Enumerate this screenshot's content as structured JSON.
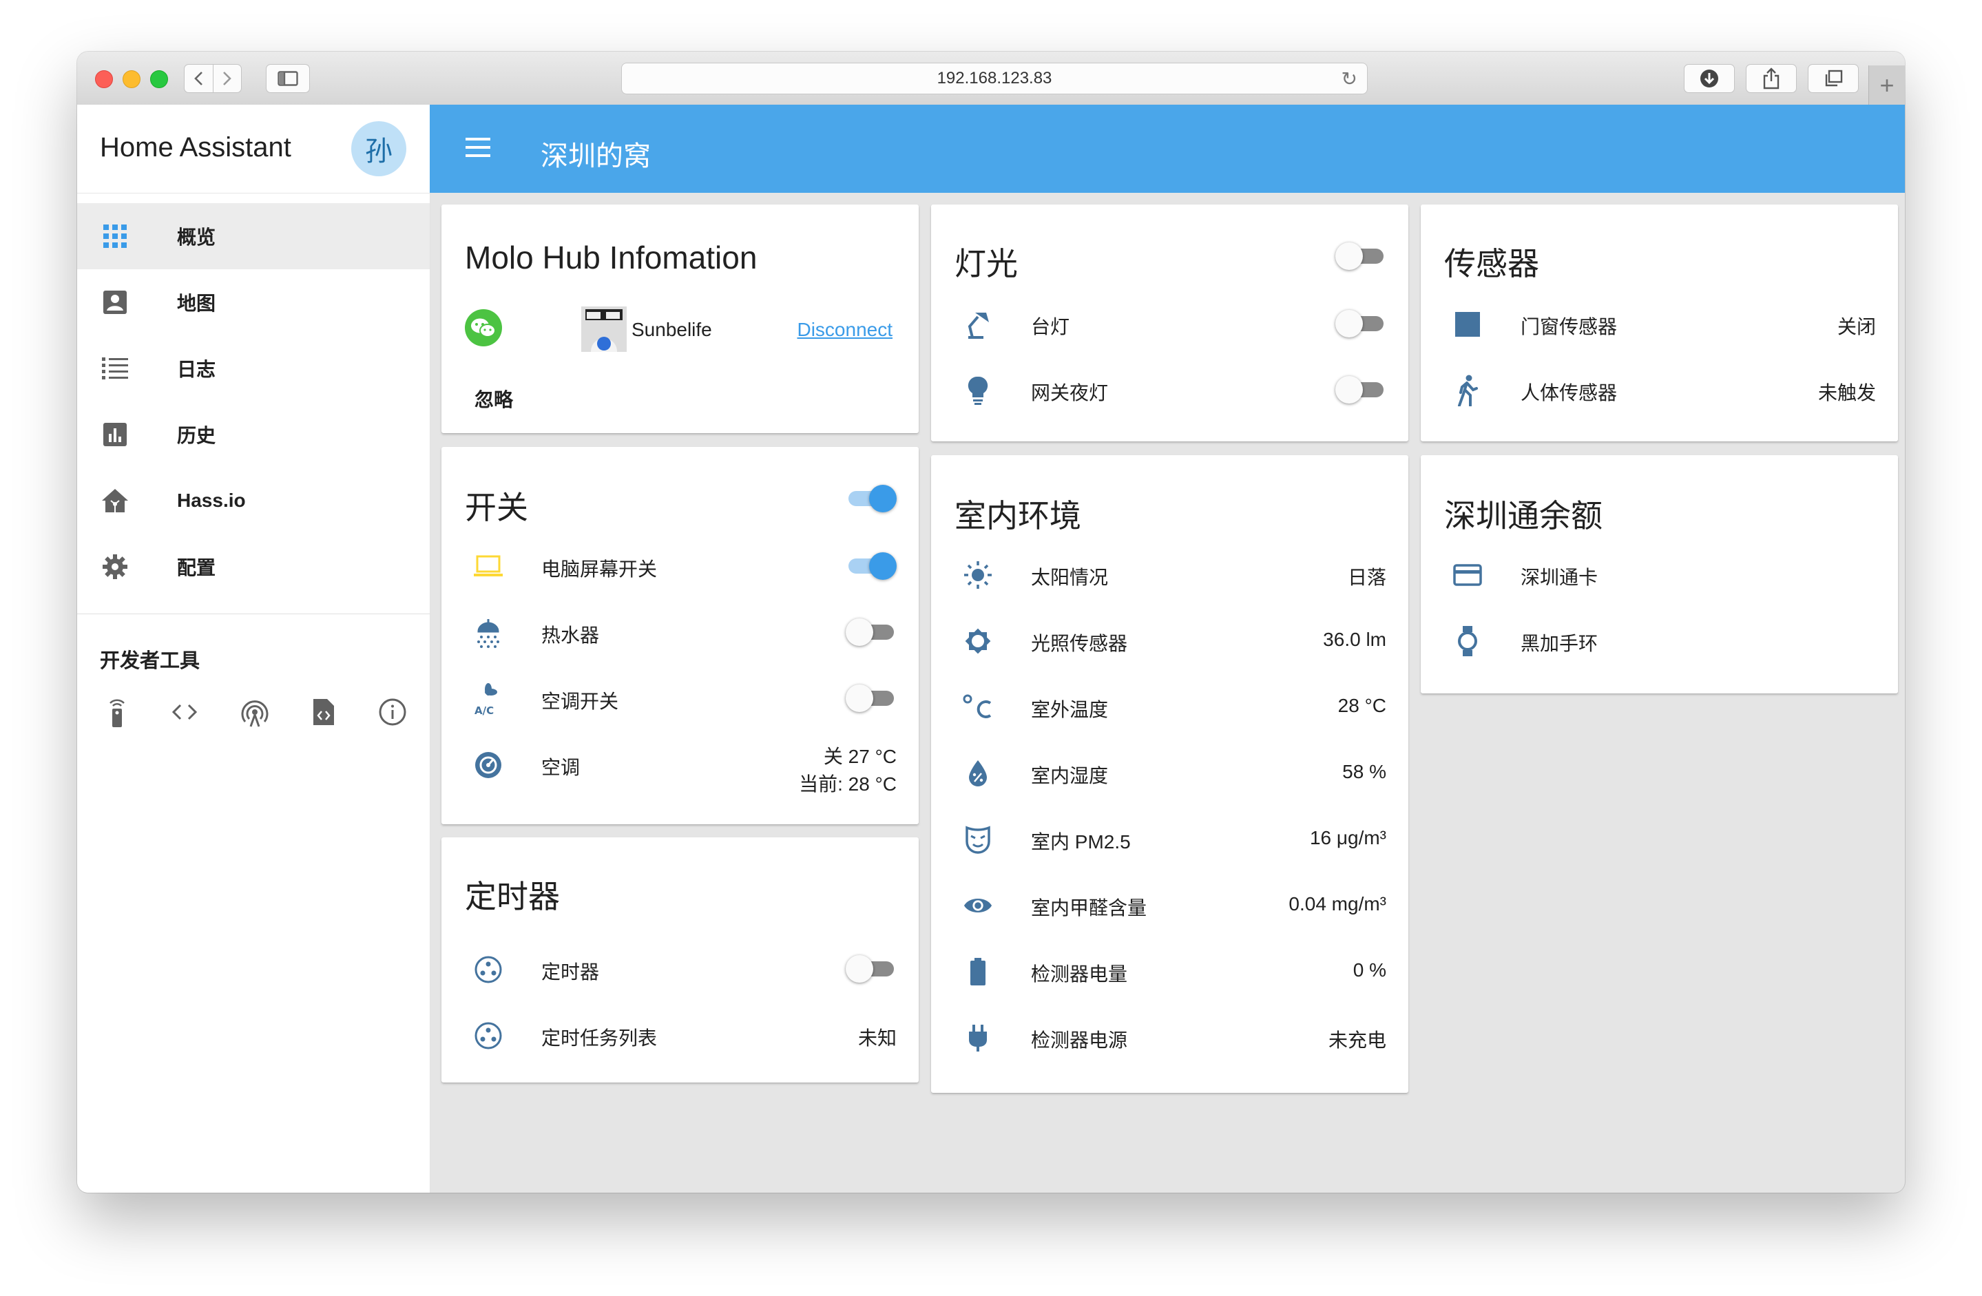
{
  "browser": {
    "url": "192.168.123.83"
  },
  "sidebar": {
    "title": "Home Assistant",
    "avatar_letter": "孙",
    "items": [
      {
        "label": "概览",
        "icon": "view-grid-icon",
        "active": true
      },
      {
        "label": "地图",
        "icon": "account-box-icon"
      },
      {
        "label": "日志",
        "icon": "format-list-icon"
      },
      {
        "label": "历史",
        "icon": "chart-box-icon"
      },
      {
        "label": "Hass.io",
        "icon": "home-assistant-icon"
      },
      {
        "label": "配置",
        "icon": "gear-icon"
      }
    ],
    "dev_tools_title": "开发者工具",
    "dev_tools": [
      "remote-icon",
      "code-brackets-icon",
      "antenna-icon",
      "file-code-icon",
      "info-icon"
    ]
  },
  "header": {
    "title": "深圳的窝"
  },
  "cards": {
    "molo": {
      "title": "Molo Hub Infomation",
      "user": "Sunbelife",
      "disconnect": "Disconnect",
      "ignore": "忽略"
    },
    "switches": {
      "title": "开关",
      "rows": [
        {
          "label": "电脑屏幕开关",
          "state": "on"
        },
        {
          "label": "热水器",
          "state": "off"
        },
        {
          "label": "空调开关",
          "state": "off"
        },
        {
          "label": "空调",
          "value": "关 27 °C",
          "sub": "当前: 28 °C"
        }
      ]
    },
    "timer": {
      "title": "定时器",
      "rows": [
        {
          "label": "定时器",
          "state": "off"
        },
        {
          "label": "定时任务列表",
          "value": "未知"
        }
      ]
    },
    "lights": {
      "title": "灯光",
      "rows": [
        {
          "label": "台灯",
          "state": "off"
        },
        {
          "label": "网关夜灯",
          "state": "off"
        }
      ]
    },
    "indoor": {
      "title": "室内环境",
      "rows": [
        {
          "label": "太阳情况",
          "value": "日落"
        },
        {
          "label": "光照传感器",
          "value": "36.0 lm"
        },
        {
          "label": "室外温度",
          "value": "28 °C"
        },
        {
          "label": "室内湿度",
          "value": "58 %"
        },
        {
          "label": "室内 PM2.5",
          "value": "16 μg/m³"
        },
        {
          "label": "室内甲醛含量",
          "value": "0.04 mg/m³"
        },
        {
          "label": "检测器电量",
          "value": "0 %"
        },
        {
          "label": "检测器电源",
          "value": "未充电"
        }
      ]
    },
    "sensors": {
      "title": "传感器",
      "rows": [
        {
          "label": "门窗传感器",
          "value": "关闭"
        },
        {
          "label": "人体传感器",
          "value": "未触发"
        }
      ]
    },
    "szt": {
      "title": "深圳通余额",
      "rows": [
        {
          "label": "深圳通卡"
        },
        {
          "label": "黑加手环"
        }
      ]
    }
  },
  "colors": {
    "accent": "#4aa6ea",
    "icon": "#44739e",
    "toggle_on": "#3a9be8"
  }
}
